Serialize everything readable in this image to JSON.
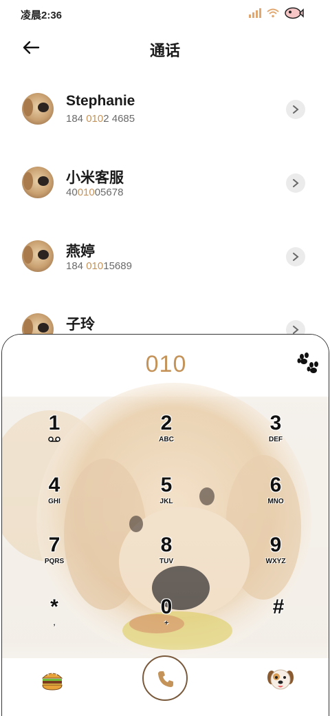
{
  "status": {
    "time": "凌晨2:36"
  },
  "header": {
    "title": "通话"
  },
  "contacts": [
    {
      "name": "Stephanie",
      "num_pre": "184 ",
      "num_hl": "010",
      "num_post": "2 4685"
    },
    {
      "name": "小米客服",
      "num_pre": "40",
      "num_hl": "010",
      "num_post": "05678"
    },
    {
      "name": "燕婷",
      "num_pre": "184 ",
      "num_hl": "010",
      "num_post": "15689"
    },
    {
      "name": "子玲",
      "num_pre": "",
      "num_hl": "",
      "num_post": ""
    }
  ],
  "dialer": {
    "number": "010",
    "keys": [
      {
        "digit": "1",
        "letters": ""
      },
      {
        "digit": "2",
        "letters": "ABC"
      },
      {
        "digit": "3",
        "letters": "DEF"
      },
      {
        "digit": "4",
        "letters": "GHI"
      },
      {
        "digit": "5",
        "letters": "JKL"
      },
      {
        "digit": "6",
        "letters": "MNO"
      },
      {
        "digit": "7",
        "letters": "PQRS"
      },
      {
        "digit": "8",
        "letters": "TUV"
      },
      {
        "digit": "9",
        "letters": "WXYZ"
      },
      {
        "digit": "*",
        "letters": ","
      },
      {
        "digit": "0",
        "letters": "+"
      },
      {
        "digit": "#",
        "letters": ""
      }
    ]
  },
  "colors": {
    "accent": "#c4935a",
    "call_border": "#7a5a3c"
  },
  "icons": [
    "back-arrow-icon",
    "chevron-right-icon",
    "paw-icon",
    "voicemail-icon",
    "burger-icon",
    "phone-icon",
    "dog-face-icon"
  ]
}
